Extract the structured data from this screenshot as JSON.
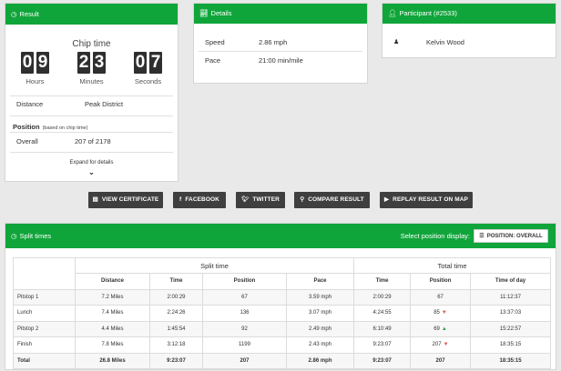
{
  "result": {
    "title": "Result",
    "chip_time_label": "Chip time",
    "hours": [
      "0",
      "9"
    ],
    "minutes": [
      "2",
      "3"
    ],
    "seconds": [
      "0",
      "7"
    ],
    "hours_label": "Hours",
    "minutes_label": "Minutes",
    "seconds_label": "Seconds",
    "distance_label": "Distance",
    "distance_value": "Peak District",
    "position_label": "Position",
    "position_sub": "(based on chip time)",
    "overall_label": "Overall",
    "overall_value": "207 of 2178",
    "expand_label": "Expand for details"
  },
  "details": {
    "title": "Details",
    "speed_label": "Speed",
    "speed_value": "2.86 mph",
    "pace_label": "Pace",
    "pace_value": "21:00 min/mile"
  },
  "participant": {
    "title": "Participant (#2533)",
    "name": "Kelvin Wood"
  },
  "buttons": {
    "certificate": "VIEW CERTIFICATE",
    "facebook": "FACEBOOK",
    "twitter": "TWITTER",
    "compare": "COMPARE RESULT",
    "replay": "REPLAY RESULT ON MAP"
  },
  "splits": {
    "title": "Split times",
    "select_label": "Select position display:",
    "select_value": "POSITION: OVERALL",
    "group_split": "Split time",
    "group_total": "Total time",
    "headers": [
      "Distance",
      "Time",
      "Position",
      "Pace",
      "Time",
      "Position",
      "Time of day"
    ],
    "rows": [
      {
        "name": "Pitstop 1",
        "distance": "7.2 Miles",
        "time": "2:00:29",
        "position": "67",
        "pace": "3.59 mph",
        "ttime": "2:00:29",
        "tpos": "67",
        "trend": "",
        "tod": "11:12:37"
      },
      {
        "name": "Lunch",
        "distance": "7.4 Miles",
        "time": "2:24:26",
        "position": "136",
        "pace": "3.07 mph",
        "ttime": "4:24:55",
        "tpos": "85",
        "trend": "down",
        "tod": "13:37:03"
      },
      {
        "name": "Pitstop 2",
        "distance": "4.4 Miles",
        "time": "1:45:54",
        "position": "92",
        "pace": "2.49 mph",
        "ttime": "6:10:49",
        "tpos": "69",
        "trend": "up",
        "tod": "15:22:57"
      },
      {
        "name": "Finish",
        "distance": "7.8 Miles",
        "time": "3:12:18",
        "position": "1199",
        "pace": "2.43 mph",
        "ttime": "9:23:07",
        "tpos": "207",
        "trend": "down",
        "tod": "18:35:15"
      }
    ],
    "total": {
      "name": "Total",
      "distance": "26.8 Miles",
      "time": "9:23:07",
      "position": "207",
      "pace": "2.86 mph",
      "ttime": "9:23:07",
      "tpos": "207",
      "tod": "18:35:15"
    }
  }
}
